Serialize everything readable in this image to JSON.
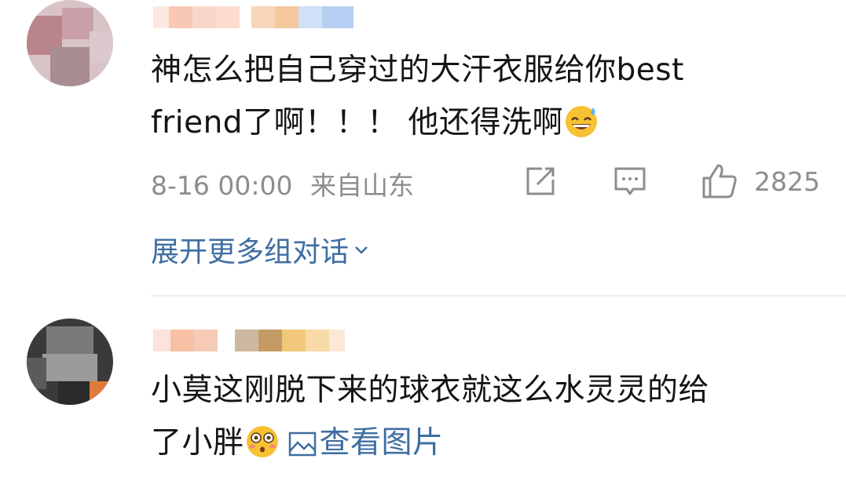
{
  "comments": [
    {
      "text": "神怎么把自己穿过的大汗衣服给你best\nfriend了啊！！！ 他还得洗啊",
      "emoji": "grinning-sweat-emoji",
      "timestamp": "8-16 00:00",
      "location": "来自山东",
      "likes": "2825",
      "expand_label": "展开更多组对话"
    },
    {
      "text": "小莫这刚脱下来的球衣就这么水灵灵的给\n了小胖",
      "emoji": "flushed-face-emoji",
      "view_images_label": "查看图片"
    }
  ],
  "colors": {
    "link": "#3e6ea2",
    "meta": "#8d8d8d",
    "text": "#141414",
    "divider": "#eeeeee"
  }
}
